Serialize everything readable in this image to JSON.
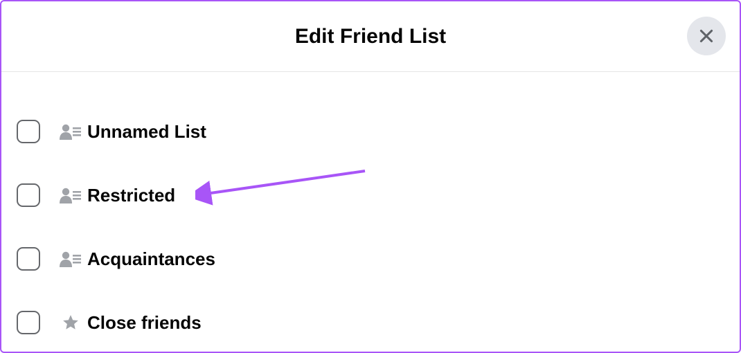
{
  "header": {
    "title": "Edit Friend List"
  },
  "items": [
    {
      "label": "Unnamed List",
      "icon": "person-list"
    },
    {
      "label": "Restricted",
      "icon": "person-list"
    },
    {
      "label": "Acquaintances",
      "icon": "person-list"
    },
    {
      "label": "Close friends",
      "icon": "star"
    }
  ]
}
